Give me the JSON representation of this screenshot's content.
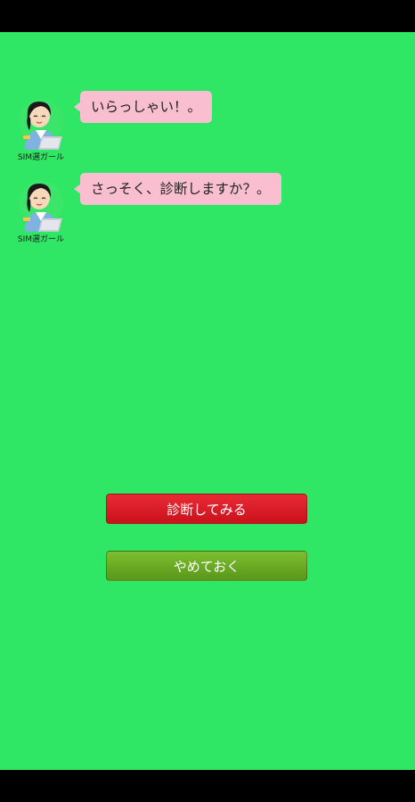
{
  "chat": {
    "messages": [
      {
        "sender": "SIM選ガール",
        "avatar_icon": "office-girl-with-laptop-icon",
        "text": "いらっしゃい！。"
      },
      {
        "sender": "SIM選ガール",
        "avatar_icon": "office-girl-with-laptop-icon",
        "text": "さっそく、診断しますか？。"
      }
    ]
  },
  "actions": {
    "diagnose_label": "診断してみる",
    "cancel_label": "やめておく"
  },
  "colors": {
    "background": "#2fe765",
    "bubble": "#f9bfd0",
    "diagnose_button": "#d81b25",
    "cancel_button": "#6aaa24"
  }
}
